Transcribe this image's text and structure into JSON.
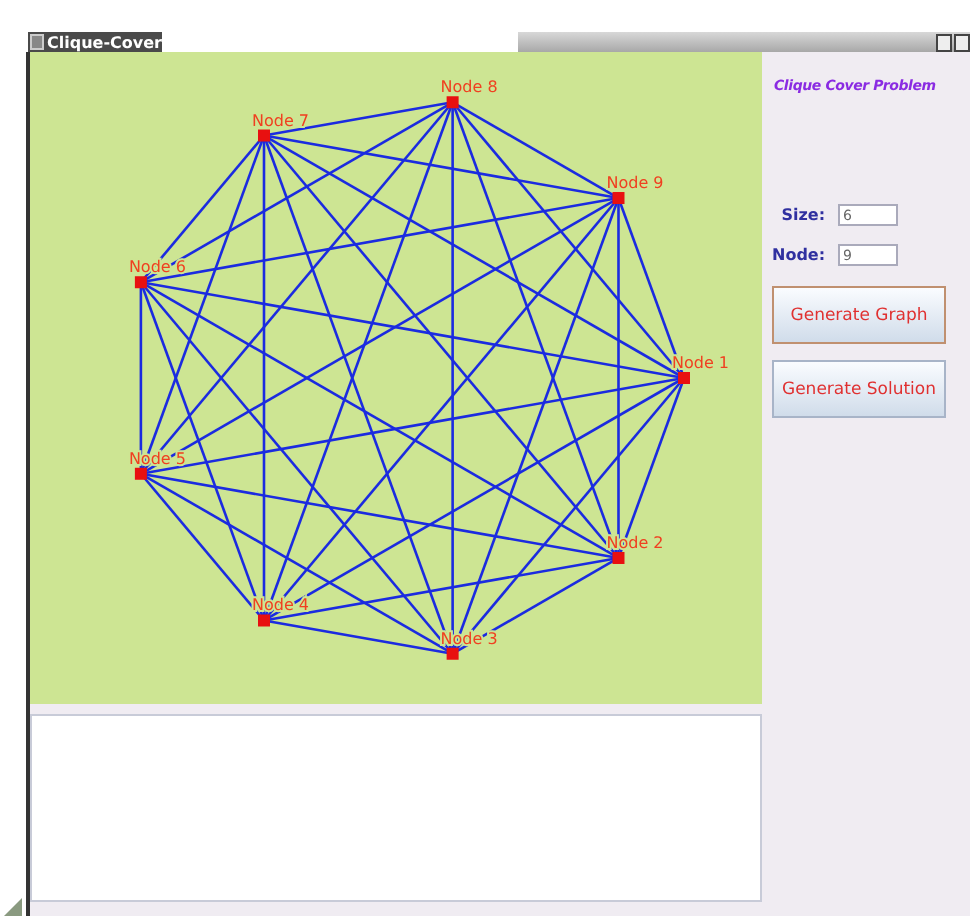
{
  "window": {
    "title": "Clique-Cover"
  },
  "graph": {
    "nodes": [
      {
        "label": "Node 1"
      },
      {
        "label": "Node 2"
      },
      {
        "label": "Node 3"
      },
      {
        "label": "Node 4"
      },
      {
        "label": "Node 5"
      },
      {
        "label": "Node 6"
      },
      {
        "label": "Node 7"
      },
      {
        "label": "Node 8"
      },
      {
        "label": "Node 9"
      }
    ]
  },
  "panel": {
    "heading": "Clique Cover Problem",
    "fields": [
      {
        "label": "Size:",
        "value": "6"
      },
      {
        "label": "Node:",
        "value": "9"
      }
    ],
    "buttons": [
      {
        "label": "Generate Graph",
        "focused": true
      },
      {
        "label": "Generate Solution",
        "focused": false
      }
    ]
  }
}
